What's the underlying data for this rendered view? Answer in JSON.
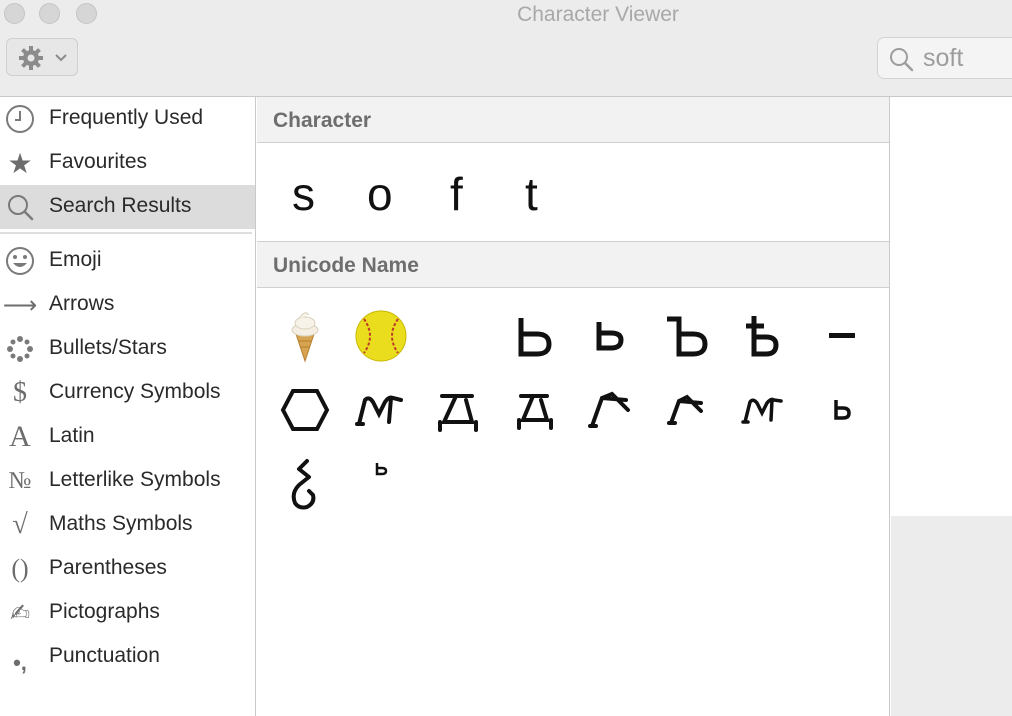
{
  "window": {
    "title": "Character Viewer"
  },
  "search": {
    "value": "soft"
  },
  "sidebar": {
    "items": [
      {
        "label": "Frequently Used",
        "icon": "clock-icon"
      },
      {
        "label": "Favourites",
        "icon": "star-icon",
        "glyph": "★"
      },
      {
        "label": "Search Results",
        "icon": "search-icon",
        "selected": true
      },
      {
        "label": "Emoji",
        "icon": "smiley-icon"
      },
      {
        "label": "Arrows",
        "icon": "arrow-icon",
        "glyph": "⟶"
      },
      {
        "label": "Bullets/Stars",
        "icon": "asterisk-icon"
      },
      {
        "label": "Currency Symbols",
        "icon": "dollar-icon",
        "glyph": "$"
      },
      {
        "label": "Latin",
        "icon": "latin-a-icon",
        "glyph": "A"
      },
      {
        "label": "Letterlike Symbols",
        "icon": "numero-icon",
        "glyph": "№"
      },
      {
        "label": "Maths Symbols",
        "icon": "square-root-icon",
        "glyph": "√"
      },
      {
        "label": "Parentheses",
        "icon": "parentheses-icon",
        "glyph": "()"
      },
      {
        "label": "Pictographs",
        "icon": "pencil-icon",
        "glyph": "✍"
      },
      {
        "label": "Punctuation",
        "icon": "punctuation-icon",
        "glyph": "•,"
      }
    ]
  },
  "main": {
    "character_section": {
      "title": "Character",
      "chars": [
        "s",
        "o",
        "f",
        "t"
      ]
    },
    "unicode_section": {
      "title": "Unicode Name",
      "glyph_icons": [
        "ice-cream-emoji-icon",
        "softball-emoji-icon",
        "blank-glyph",
        "cyrillic-soft-sign-upper-icon",
        "cyrillic-soft-sign-lower-icon",
        "cyrillic-hard-sign-upper-icon",
        "cyrillic-hard-sign-lower-icon",
        "short-dash-icon",
        "hexagon-icon",
        "glagolitic-m-icon",
        "glagolitic-d-icon",
        "glagolitic-d-small-icon",
        "glagolitic-l-icon",
        "glagolitic-l-small-icon",
        "glagolitic-m-small-icon",
        "cyrillic-soft-sign-small-icon",
        "glagolitic-zemlja-icon",
        "superscript-soft-sign-icon"
      ]
    }
  },
  "colors": {
    "selection": "#dcdcdc",
    "header_text": "#6e6e6e",
    "softball": "#f0e020"
  }
}
